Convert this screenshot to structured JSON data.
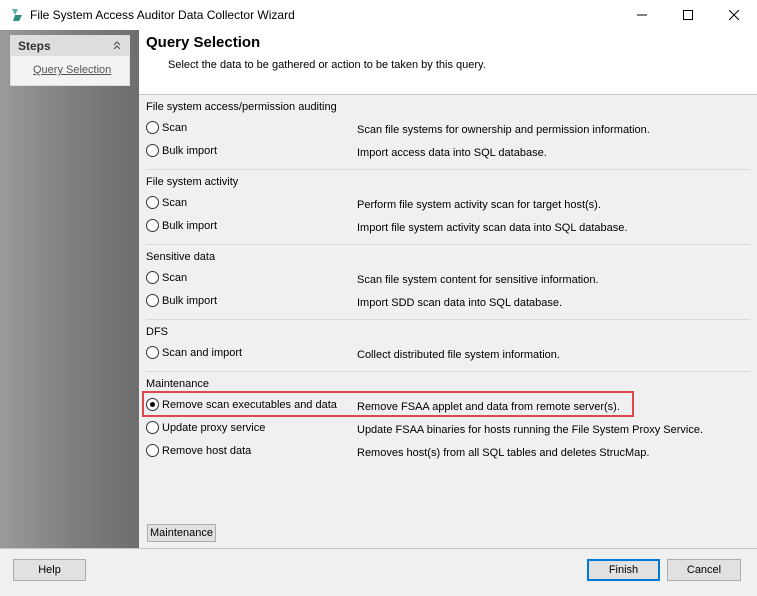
{
  "window": {
    "title": "File System Access Auditor Data Collector Wizard",
    "icon": "app-logo-icon",
    "controls": [
      "minimize-icon",
      "maximize-icon",
      "close-icon"
    ]
  },
  "sidebar": {
    "title": "Steps",
    "items": [
      {
        "label": "Query Selection"
      }
    ]
  },
  "header": {
    "title": "Query Selection",
    "subtitle": "Select the data to be gathered or action to be taken by this query."
  },
  "groups": [
    {
      "label": "File system access/permission auditing",
      "options": [
        {
          "label": "Scan",
          "desc": "Scan file systems for ownership and permission information.",
          "selected": false
        },
        {
          "label": "Bulk import",
          "desc": "Import access data into SQL database.",
          "selected": false
        }
      ]
    },
    {
      "label": "File system activity",
      "options": [
        {
          "label": "Scan",
          "desc": "Perform file system activity scan for target host(s).",
          "selected": false
        },
        {
          "label": "Bulk import",
          "desc": "Import file system activity scan data into SQL database.",
          "selected": false
        }
      ]
    },
    {
      "label": "Sensitive data",
      "options": [
        {
          "label": "Scan",
          "desc": "Scan file system content for sensitive information.",
          "selected": false
        },
        {
          "label": "Bulk import",
          "desc": "Import SDD scan data into SQL database.",
          "selected": false
        }
      ]
    },
    {
      "label": "DFS",
      "options": [
        {
          "label": "Scan and import",
          "desc": "Collect distributed file system information.",
          "selected": false
        }
      ]
    },
    {
      "label": "Maintenance",
      "options": [
        {
          "label": "Remove scan executables and data",
          "desc": "Remove FSAA applet and data from remote server(s).",
          "selected": true
        },
        {
          "label": "Update proxy service",
          "desc": "Update FSAA binaries for hosts running the File System Proxy Service.",
          "selected": false
        },
        {
          "label": "Remove host data",
          "desc": "Removes host(s) from all SQL tables and deletes StrucMap.",
          "selected": false
        }
      ]
    }
  ],
  "maintenance_button": "Maintenance",
  "footer": {
    "help": "Help",
    "finish": "Finish",
    "cancel": "Cancel"
  },
  "colors": {
    "highlight_border": "#e0474c",
    "accent": "#0078d7"
  }
}
